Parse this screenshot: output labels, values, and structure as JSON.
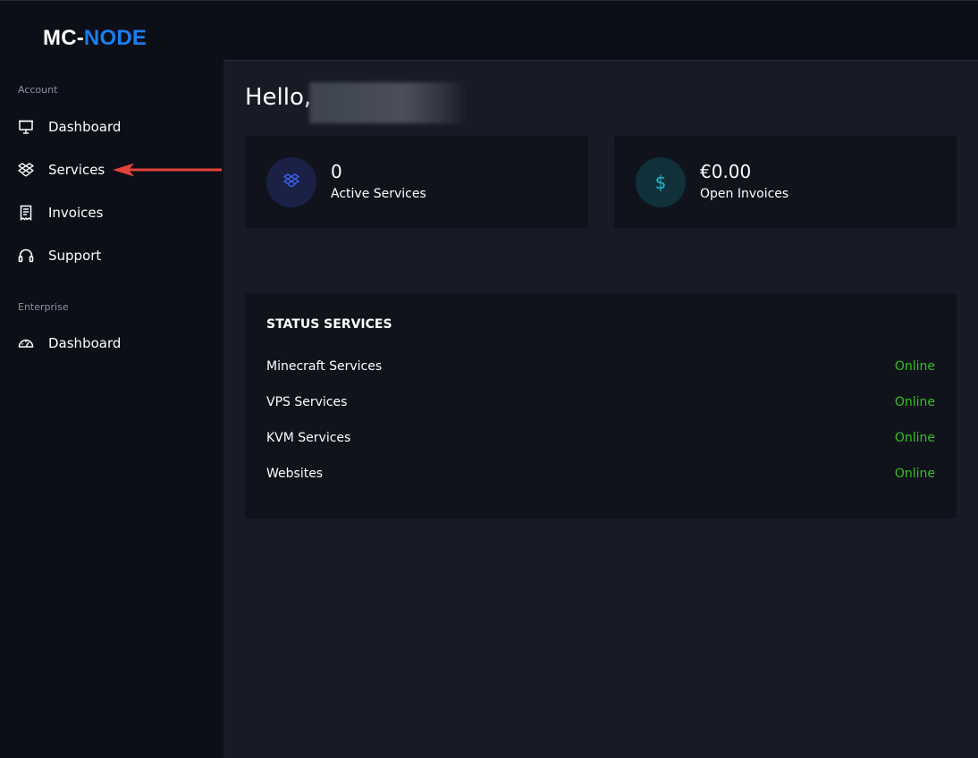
{
  "brand": {
    "part1": "MC-",
    "part2": "NODE"
  },
  "sidebar": {
    "sections": [
      {
        "title": "Account",
        "items": [
          {
            "label": "Dashboard",
            "icon": "monitor-icon"
          },
          {
            "label": "Services",
            "icon": "dropbox-icon"
          },
          {
            "label": "Invoices",
            "icon": "receipt-icon"
          },
          {
            "label": "Support",
            "icon": "headphones-icon"
          }
        ]
      },
      {
        "title": "Enterprise",
        "items": [
          {
            "label": "Dashboard",
            "icon": "speedometer-icon"
          }
        ]
      }
    ]
  },
  "greeting": {
    "text": "Hello,"
  },
  "stats": [
    {
      "value": "0",
      "label": "Active Services",
      "icon": "dropbox-icon",
      "color": "#3a64f0"
    },
    {
      "value": "€0.00",
      "label": "Open Invoices",
      "icon": "dollar-icon",
      "symbol": "$",
      "color": "#21b8cc"
    }
  ],
  "status": {
    "title": "STATUS SERVICES",
    "rows": [
      {
        "name": "Minecraft Services",
        "state": "Online"
      },
      {
        "name": "VPS Services",
        "state": "Online"
      },
      {
        "name": "KVM Services",
        "state": "Online"
      },
      {
        "name": "Websites",
        "state": "Online"
      }
    ],
    "online_color": "#32c11f"
  },
  "colors": {
    "background": "#0c0f17",
    "main": "#181b26",
    "card": "#10131c",
    "accent": "#1c7df0",
    "annotation_arrow": "#e5423a"
  }
}
